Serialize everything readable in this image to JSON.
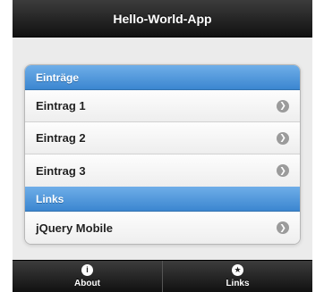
{
  "header": {
    "title": "Hello-World-App"
  },
  "list": {
    "sections": [
      {
        "divider": "Einträge",
        "items": [
          "Eintrag 1",
          "Eintrag 2",
          "Eintrag 3"
        ]
      },
      {
        "divider": "Links",
        "items": [
          "jQuery Mobile"
        ]
      }
    ],
    "arrow_glyph": "❯"
  },
  "footer": {
    "tabs": [
      {
        "label": "About",
        "icon": "info-icon",
        "glyph": "i"
      },
      {
        "label": "Links",
        "icon": "star-icon",
        "glyph": "★"
      }
    ]
  },
  "colors": {
    "header_bg": "#1a1a1a",
    "divider_bg": "#4a93d8",
    "page_bg": "#ebebeb"
  }
}
